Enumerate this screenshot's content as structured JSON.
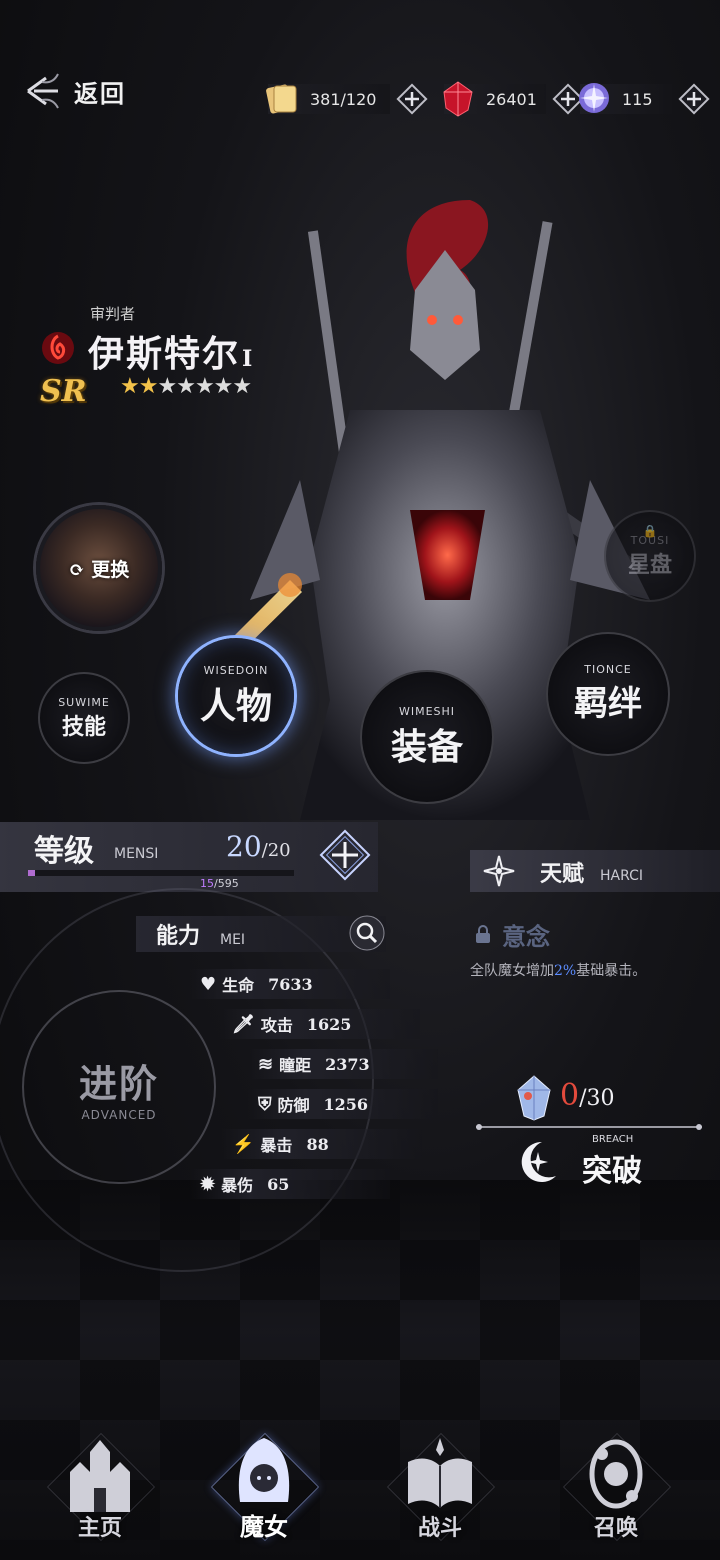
{
  "topbar": {
    "back_label": "返回",
    "resources": [
      {
        "icon": "ticket-icon",
        "value": "381/120"
      },
      {
        "icon": "ruby-gem-icon",
        "value": "26401"
      },
      {
        "icon": "crystal-orb-icon",
        "value": "115"
      }
    ]
  },
  "character": {
    "class": "审判者",
    "name": "伊斯特尔",
    "name_suffix": "I",
    "rarity": "SR",
    "stars_filled": 2,
    "stars_total": 7
  },
  "buttons": {
    "swap": "更换",
    "starmap": {
      "sub": "TOUSI",
      "main": "星盘"
    },
    "skill": {
      "sub": "SUWIME",
      "main": "技能"
    },
    "person": {
      "sub": "WISEDOIN",
      "main": "人物"
    },
    "equip": {
      "sub": "WIMESHI",
      "main": "装备"
    },
    "bond": {
      "sub": "TIONCE",
      "main": "羁绊"
    }
  },
  "level": {
    "title": "等级",
    "title_en": "MENSI",
    "current": "20",
    "max": "/20",
    "xp_current": "15",
    "xp_total": "/595",
    "xp_fraction": 0.025
  },
  "talent": {
    "title": "天赋",
    "title_en": "HARCI",
    "name": "意念",
    "desc_pre": "全队魔女增加",
    "desc_value": "2%",
    "desc_post": "基础暴击。"
  },
  "ability": {
    "title": "能力",
    "title_en": "MEI",
    "stats": [
      {
        "icon": "heart-icon",
        "label": "生命",
        "value": "7633"
      },
      {
        "icon": "sword-icon",
        "label": "攻击",
        "value": "1625"
      },
      {
        "icon": "wing-icon",
        "label": "瞳距",
        "value": "2373"
      },
      {
        "icon": "shield-icon",
        "label": "防御",
        "value": "1256"
      },
      {
        "icon": "crit-icon",
        "label": "暴击",
        "value": "88"
      },
      {
        "icon": "burst-icon",
        "label": "暴伤",
        "value": "65"
      }
    ]
  },
  "advance": {
    "main": "进阶",
    "sub": "ADVANCED"
  },
  "breakthrough": {
    "count": "0",
    "total": "/30",
    "sub": "BREACH",
    "main": "突破"
  },
  "nav": [
    {
      "label": "主页"
    },
    {
      "label": "魔女"
    },
    {
      "label": "战斗"
    },
    {
      "label": "召唤"
    }
  ]
}
